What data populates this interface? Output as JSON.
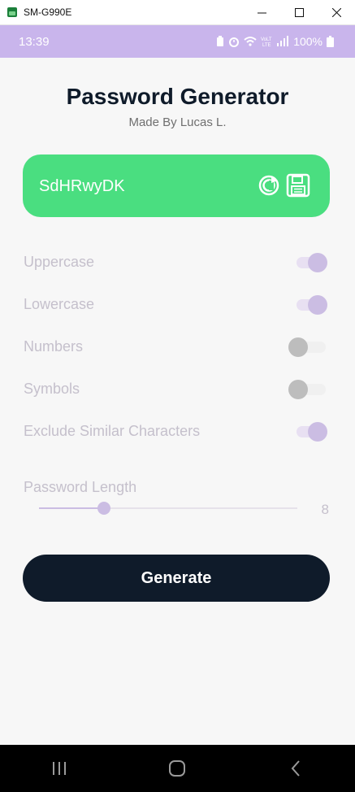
{
  "window": {
    "title": "SM-G990E"
  },
  "status_bar": {
    "time": "13:39",
    "battery": "100%",
    "icons": [
      "battery-saver-icon",
      "alarm-icon",
      "wifi-icon",
      "volte-icon",
      "signal-icon",
      "battery-icon"
    ]
  },
  "app": {
    "title": "Password Generator",
    "subtitle": "Made By Lucas L.",
    "password": "SdHRwyDK",
    "colors": {
      "card": "#4ade80",
      "accent": "#cbbde3",
      "button": "#0f1b2a",
      "statusbar": "#c9b5ec"
    }
  },
  "options": [
    {
      "label": "Uppercase",
      "enabled": true
    },
    {
      "label": "Lowercase",
      "enabled": true
    },
    {
      "label": "Numbers",
      "enabled": false
    },
    {
      "label": "Symbols",
      "enabled": false
    },
    {
      "label": "Exclude Similar Characters",
      "enabled": true
    }
  ],
  "length": {
    "label": "Password Length",
    "value": "8",
    "fraction": 0.25
  },
  "generate_button": "Generate",
  "nav": {
    "icons": [
      "recent-apps-icon",
      "home-icon",
      "back-icon"
    ]
  }
}
